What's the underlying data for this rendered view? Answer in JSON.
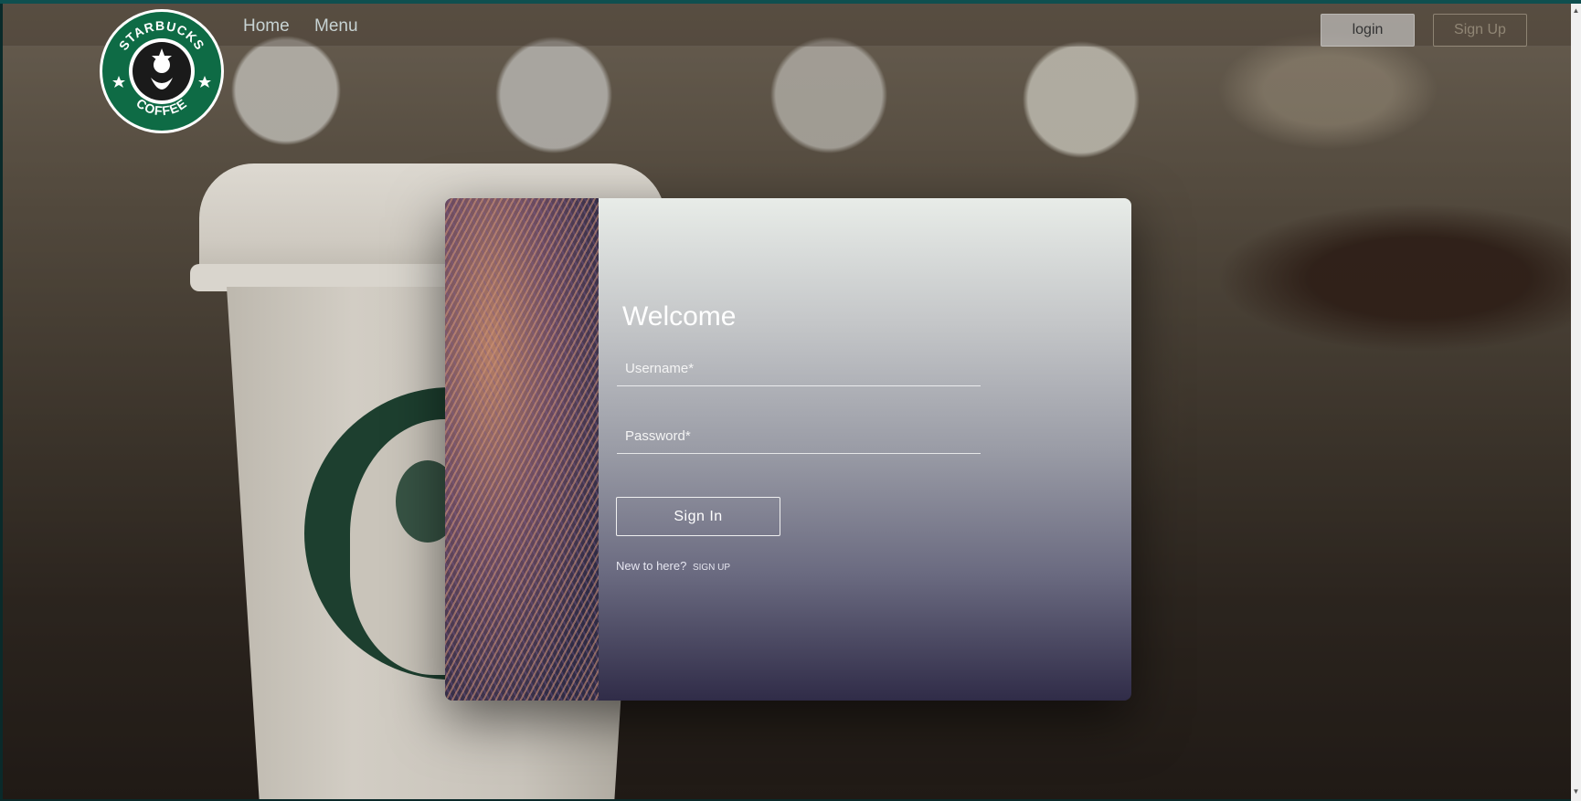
{
  "brand": {
    "logo_top_text": "STARBUCKS",
    "logo_bottom_text": "COFFEE",
    "logo_color": "#0e6b45"
  },
  "nav": {
    "home_label": "Home",
    "menu_label": "Menu"
  },
  "header_actions": {
    "login_label": "login",
    "signup_label": "Sign Up"
  },
  "login_form": {
    "title": "Welcome",
    "username_placeholder": "Username*",
    "password_placeholder": "Password*",
    "submit_label": "Sign In",
    "new_here_text": "New to here?",
    "signup_link_label": "SIGN UP"
  },
  "icons": {
    "scroll_up": "chevron-up-icon",
    "scroll_down": "chevron-down-icon"
  },
  "colors": {
    "modal_gradient_top": "#e8ece8",
    "modal_gradient_bottom": "#302c48",
    "accent_border": "#f0f0f0"
  }
}
